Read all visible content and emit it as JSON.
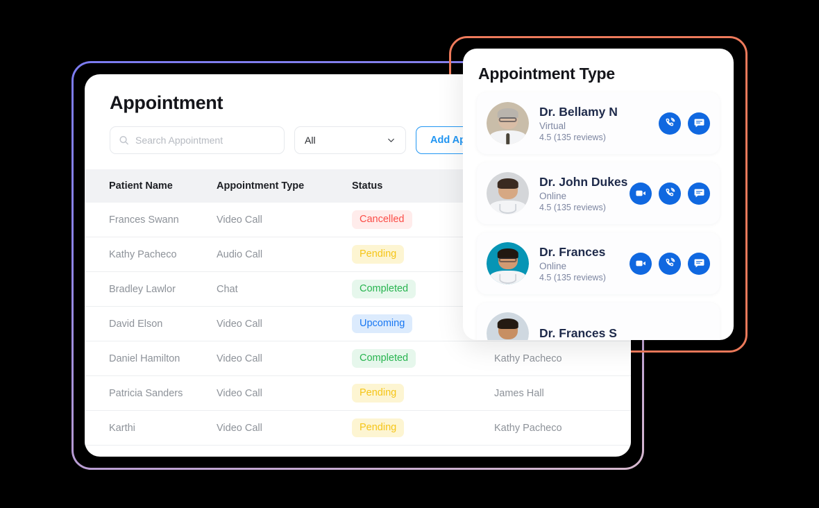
{
  "theme": {
    "background": "#000000",
    "accent_blue": "#2196f3",
    "action_blue": "#1068e0",
    "outline_purple": "#7b7bf0",
    "outline_coral": "#ef7b5c"
  },
  "appointment_panel": {
    "title": "Appointment",
    "search": {
      "placeholder": "Search Appointment",
      "value": "",
      "icon": "search-icon"
    },
    "filter": {
      "value": "All",
      "icon": "chevron-down-icon",
      "options": [
        "All"
      ]
    },
    "add_button": {
      "label": "Add Appointment",
      "truncated_label": "Add Appo"
    },
    "table": {
      "columns": [
        "Patient Name",
        "Appointment Type",
        "Status",
        ""
      ],
      "rows": [
        {
          "patient_name": "Frances Swann",
          "appointment_type": "Video Call",
          "status": "Cancelled",
          "status_kind": "cancelled",
          "doctor": ""
        },
        {
          "patient_name": "Kathy Pacheco",
          "appointment_type": "Audio Call",
          "status": "Pending",
          "status_kind": "pending",
          "doctor": ""
        },
        {
          "patient_name": "Bradley Lawlor",
          "appointment_type": "Chat",
          "status": "Completed",
          "status_kind": "completed",
          "doctor": ""
        },
        {
          "patient_name": "David Elson",
          "appointment_type": "Video Call",
          "status": "Upcoming",
          "status_kind": "upcoming",
          "doctor": ""
        },
        {
          "patient_name": "Daniel Hamilton",
          "appointment_type": "Video Call",
          "status": "Completed",
          "status_kind": "completed",
          "doctor": "Kathy Pacheco"
        },
        {
          "patient_name": "Patricia Sanders",
          "appointment_type": "Video Call",
          "status": "Pending",
          "status_kind": "pending",
          "doctor": "James Hall"
        },
        {
          "patient_name": "Karthi",
          "appointment_type": "Video Call",
          "status": "Pending",
          "status_kind": "pending",
          "doctor": "Kathy Pacheco"
        }
      ]
    }
  },
  "appointment_type_panel": {
    "title": "Appointment Type",
    "doctors": [
      {
        "name": "Dr. Bellamy N",
        "status": "Virtual",
        "rating": "4.5 (135 reviews)",
        "actions": [
          "audio-call-icon",
          "chat-icon"
        ]
      },
      {
        "name": "Dr. John Dukes",
        "status": "Online",
        "rating": "4.5 (135 reviews)",
        "actions": [
          "video-call-icon",
          "audio-call-icon",
          "chat-icon"
        ]
      },
      {
        "name": "Dr. Frances",
        "status": "Online",
        "rating": "4.5 (135 reviews)",
        "actions": [
          "video-call-icon",
          "audio-call-icon",
          "chat-icon"
        ]
      }
    ]
  }
}
